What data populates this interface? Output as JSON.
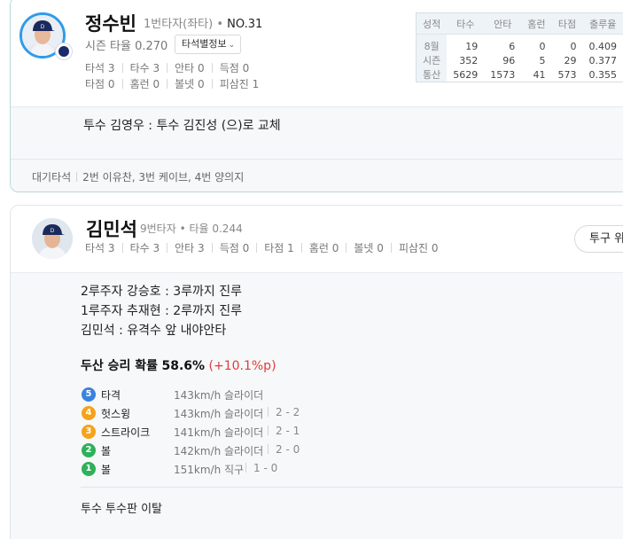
{
  "colors": {
    "accent_blue": "#2f9bea",
    "positive_red": "#e03b3b",
    "ball_green": "#2fb05a",
    "strike_orange": "#f4a31b",
    "hit_blue": "#3a82e0"
  },
  "card1": {
    "player": {
      "name": "정수빈",
      "role": "1번타자(좌타)",
      "number": "NO.31",
      "season_avg": "시즌 타율 0.270",
      "dropdown_label": "타석별정보",
      "avatar_icon": "player-avatar"
    },
    "stats": [
      {
        "label": "타석",
        "value": "3"
      },
      {
        "label": "타수",
        "value": "3"
      },
      {
        "label": "안타",
        "value": "0"
      },
      {
        "label": "득점",
        "value": "0"
      },
      {
        "label": "타점",
        "value": "0"
      },
      {
        "label": "홈런",
        "value": "0"
      },
      {
        "label": "볼넷",
        "value": "0"
      },
      {
        "label": "피삼진",
        "value": "1"
      }
    ],
    "table": {
      "headers": [
        "성적",
        "타수",
        "안타",
        "홈런",
        "타점",
        "출루율"
      ],
      "rows": [
        [
          "8월",
          "19",
          "6",
          "0",
          "0",
          "0.409"
        ],
        [
          "시즌",
          "352",
          "96",
          "5",
          "29",
          "0.377"
        ],
        [
          "통산",
          "5629",
          "1573",
          "41",
          "573",
          "0.355"
        ]
      ]
    },
    "event": "투수 김영우 : 투수 김진성 (으)로 교체",
    "waiting_label": "대기타석",
    "waiting_text": "2번 이유찬, 3번 케이브, 4번 양의지"
  },
  "card2": {
    "player": {
      "name": "김민석",
      "meta": "9번타자 • 타율 0.244",
      "avatar_icon": "player-avatar"
    },
    "stats": [
      {
        "label": "타석",
        "value": "3"
      },
      {
        "label": "타수",
        "value": "3"
      },
      {
        "label": "안타",
        "value": "3"
      },
      {
        "label": "득점",
        "value": "0"
      },
      {
        "label": "타점",
        "value": "1"
      },
      {
        "label": "홈런",
        "value": "0"
      },
      {
        "label": "볼넷",
        "value": "0"
      },
      {
        "label": "피삼진",
        "value": "0"
      }
    ],
    "pitch_button": "투구 위",
    "events": [
      "2루주자 강승호 : 3루까지 진루",
      "1루주자 추재현 : 2루까지 진루",
      "김민석 : 유격수 앞 내야안타"
    ],
    "win_prob": {
      "label": "두산 승리 확률",
      "value": "58.6%",
      "delta": "(+10.1%p)"
    },
    "pitches": [
      {
        "no": "5",
        "result": "타격",
        "speed": "143km/h 슬라이더",
        "count": "",
        "color": "#3a82e0"
      },
      {
        "no": "4",
        "result": "헛스윙",
        "speed": "143km/h 슬라이더",
        "count": "2 - 2",
        "color": "#f4a31b"
      },
      {
        "no": "3",
        "result": "스트라이크",
        "speed": "141km/h 슬라이더",
        "count": "2 - 1",
        "color": "#f4a31b"
      },
      {
        "no": "2",
        "result": "볼",
        "speed": "142km/h 슬라이더",
        "count": "2 - 0",
        "color": "#2fb05a"
      },
      {
        "no": "1",
        "result": "볼",
        "speed": "151km/h 직구",
        "count": "1 - 0",
        "color": "#2fb05a"
      }
    ],
    "last_event": "투수 투수판 이탈"
  }
}
